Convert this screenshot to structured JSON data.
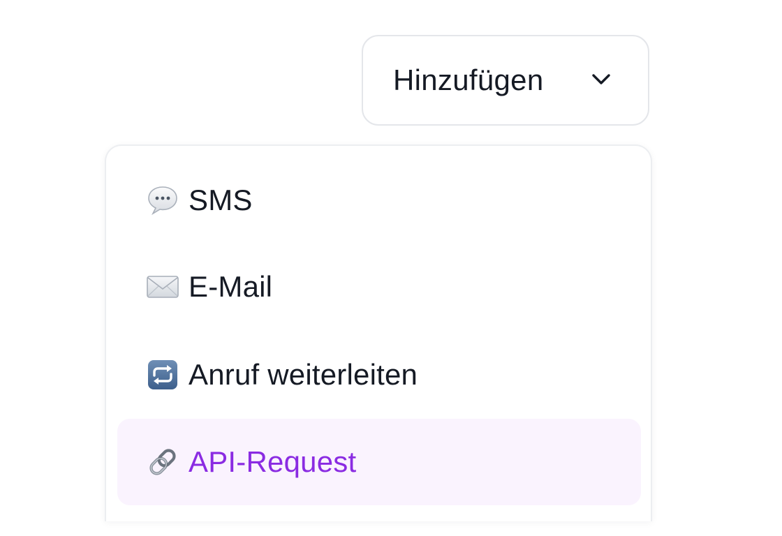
{
  "add_button": {
    "label": "Hinzufügen",
    "icon": "chevron-down-icon"
  },
  "menu": {
    "items": [
      {
        "label": "SMS",
        "icon": "speech-bubble-icon",
        "highlighted": false
      },
      {
        "label": "E-Mail",
        "icon": "envelope-icon",
        "highlighted": false
      },
      {
        "label": "Anruf weiterleiten",
        "icon": "repeat-icon",
        "highlighted": false
      },
      {
        "label": "API-Request",
        "icon": "link-icon",
        "highlighted": true
      }
    ]
  },
  "colors": {
    "text": "#151a24",
    "highlight_background": "#faf3fe",
    "highlight_text": "#8a2be2",
    "border": "#e4e6ea"
  }
}
